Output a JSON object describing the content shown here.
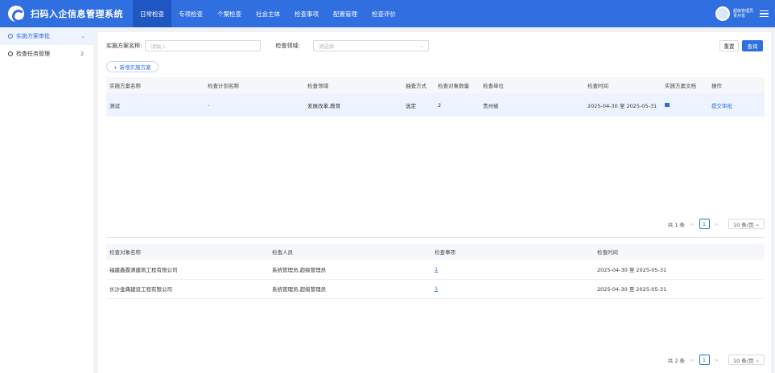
{
  "app": {
    "title": "扫码入企信息管理系统"
  },
  "nav": [
    {
      "label": "日常检查"
    },
    {
      "label": "专项检查"
    },
    {
      "label": "个案检查"
    },
    {
      "label": "社会主体"
    },
    {
      "label": "检查事项"
    },
    {
      "label": "配置管理"
    },
    {
      "label": "检查评价"
    }
  ],
  "user": {
    "name": "超级管理员",
    "region": "贵州省"
  },
  "sidebar": {
    "items": [
      {
        "label": "实施方案审批"
      },
      {
        "label": "检查任务管理",
        "badge": "2"
      }
    ]
  },
  "filter": {
    "name_label": "实施方案名称:",
    "name_placeholder": "请输入",
    "field_label": "检查领域:",
    "field_placeholder": "请选择",
    "reset": "重置",
    "query": "查询"
  },
  "add_button": "+ 新增实施方案",
  "plans": {
    "headers": [
      "实施方案名称",
      "检查计划名称",
      "检查领域",
      "抽查方式",
      "检查对象数量",
      "检查单位",
      "检查时间",
      "实施方案文档",
      "操作"
    ],
    "rows": [
      {
        "name": "测试",
        "plan": "-",
        "field": "发展改革,教育",
        "method": "选定",
        "count": "2",
        "unit": "贵州省",
        "time": "2025-04-30 至 2025-05-31",
        "action": "提交审批"
      }
    ],
    "pager": {
      "total": "共 1 条",
      "page": "1",
      "size": "10 条/页"
    }
  },
  "targets": {
    "headers": [
      "检查对象名称",
      "检查人员",
      "检查事项",
      "检查时间"
    ],
    "rows": [
      {
        "name": "福建鑫霆源建筑工程有限公司",
        "people": "系统管理员,超级管理员",
        "items": "1",
        "time": "2025-04-30 至 2025-05-31"
      },
      {
        "name": "长沙金典建设工程有限公司",
        "people": "系统管理员,超级管理员",
        "items": "1",
        "time": "2025-04-30 至 2025-05-31"
      }
    ],
    "pager": {
      "total": "共 2 条",
      "page": "1",
      "size": "10 条/页"
    }
  }
}
